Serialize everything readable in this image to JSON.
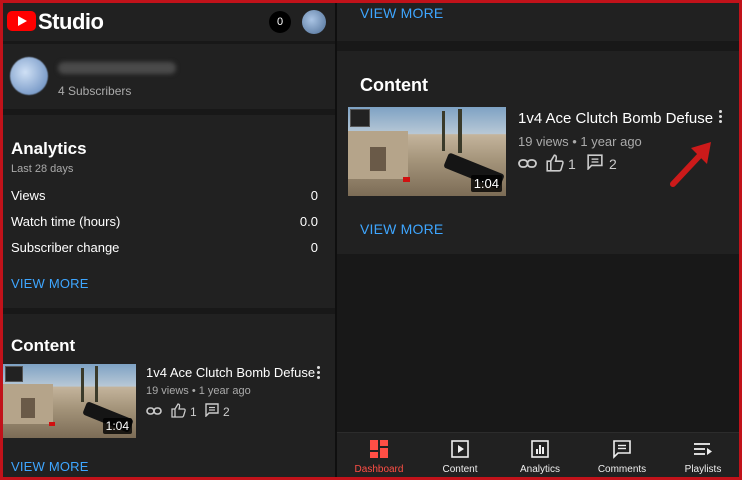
{
  "app": {
    "title": "Studio",
    "notification_count": "0"
  },
  "channel": {
    "subscribers": "4 Subscribers"
  },
  "analytics": {
    "title": "Analytics",
    "period": "Last 28 days",
    "metrics": [
      {
        "label": "Views",
        "value": "0"
      },
      {
        "label": "Watch time (hours)",
        "value": "0.0"
      },
      {
        "label": "Subscriber change",
        "value": "0"
      }
    ],
    "view_more": "VIEW MORE"
  },
  "content": {
    "title": "Content",
    "video": {
      "title": "1v4 Ace Clutch Bomb Defuse",
      "meta": "19 views • 1 year ago",
      "duration": "1:04",
      "likes": "1",
      "comments": "2"
    },
    "view_more": "VIEW MORE"
  },
  "right_panel": {
    "top_view_more": "VIEW MORE",
    "content_title": "Content",
    "video": {
      "title": "1v4 Ace Clutch Bomb Defuse",
      "meta": "19 views • 1 year ago",
      "duration": "1:04",
      "likes": "1",
      "comments": "2"
    },
    "view_more": "VIEW MORE"
  },
  "bottom_nav": {
    "items": [
      {
        "label": "Dashboard",
        "icon": "dashboard-icon",
        "active": true
      },
      {
        "label": "Content",
        "icon": "content-icon"
      },
      {
        "label": "Analytics",
        "icon": "analytics-icon"
      },
      {
        "label": "Comments",
        "icon": "comments-icon"
      },
      {
        "label": "Playlists",
        "icon": "playlists-icon"
      }
    ]
  },
  "colors": {
    "accent_link": "#3ea6ff",
    "active_nav": "#ff4e45",
    "youtube_red": "#ff0000",
    "annotation_arrow": "#cc1a1a"
  }
}
